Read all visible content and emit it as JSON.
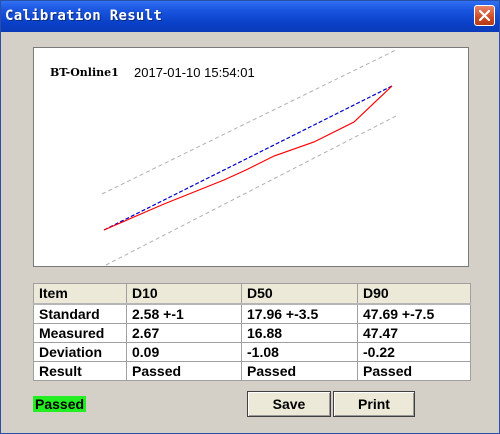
{
  "window": {
    "title": "Calibration Result",
    "close_icon": "close-icon"
  },
  "plot": {
    "device": "BT-Online1",
    "timestamp": "2017-01-10 15:54:01",
    "colors": {
      "measured": "#ff0000",
      "standard": "#0000cc",
      "limits": "#b0b0b0"
    }
  },
  "table": {
    "headers": [
      "Item",
      "D10",
      "D50",
      "D90"
    ],
    "rows": [
      [
        "Standard",
        "2.58 +-1",
        "17.96 +-3.5",
        "47.69 +-7.5"
      ],
      [
        "Measured",
        "2.67",
        "16.88",
        "47.47"
      ],
      [
        "Deviation",
        "0.09",
        "-1.08",
        "-0.22"
      ],
      [
        "Result",
        "Passed",
        "Passed",
        "Passed"
      ]
    ]
  },
  "status": {
    "text": "Passed",
    "color": "#22ee22"
  },
  "buttons": {
    "save": "Save",
    "print": "Print"
  }
}
